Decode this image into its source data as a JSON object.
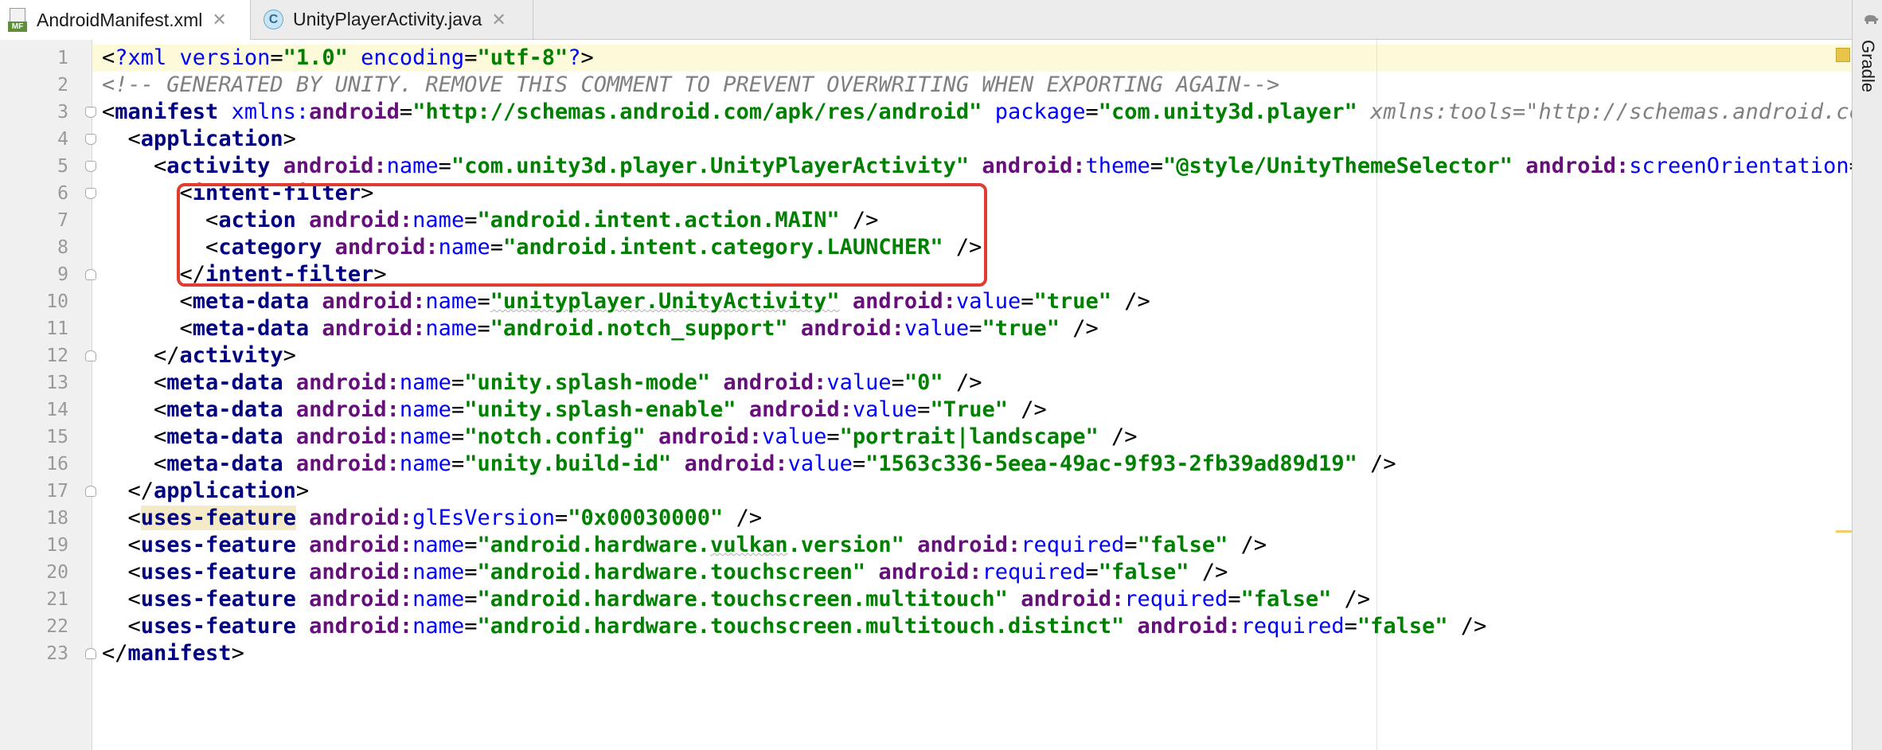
{
  "tabs": [
    {
      "label": "AndroidManifest.xml",
      "icon": "manifest-file-icon",
      "active": true
    },
    {
      "label": "UnityPlayerActivity.java",
      "icon": "java-class-icon",
      "active": false
    }
  ],
  "tab_close_glyph": "✕",
  "manifest_icon_badge": "MF",
  "java_icon_letter": "C",
  "side_panel": {
    "label": "Gradle",
    "icon": "gradle-icon"
  },
  "line_numbers": [
    "1",
    "2",
    "3",
    "4",
    "5",
    "6",
    "7",
    "8",
    "9",
    "10",
    "11",
    "12",
    "13",
    "14",
    "15",
    "16",
    "17",
    "18",
    "19",
    "20",
    "21",
    "22",
    "23"
  ],
  "lines": [
    [
      {
        "c": "p",
        "t": "<"
      },
      {
        "c": "pi",
        "t": "?xml version"
      },
      {
        "c": "p",
        "t": "="
      },
      {
        "c": "v",
        "t": "\"1.0\""
      },
      {
        "c": "pi",
        "t": " encoding"
      },
      {
        "c": "p",
        "t": "="
      },
      {
        "c": "v",
        "t": "\"utf-8\""
      },
      {
        "c": "pi",
        "t": "?"
      },
      {
        "c": "p",
        "t": ">"
      }
    ],
    [
      {
        "c": "cm",
        "t": "<!-- GENERATED BY UNITY. REMOVE THIS COMMENT TO PREVENT OVERWRITING WHEN EXPORTING AGAIN-->"
      }
    ],
    [
      {
        "c": "p",
        "t": "<"
      },
      {
        "c": "t",
        "t": "manifest"
      },
      {
        "c": "p",
        "t": " "
      },
      {
        "c": "an",
        "t": "xmlns:"
      },
      {
        "c": "ns",
        "t": "android"
      },
      {
        "c": "p",
        "t": "="
      },
      {
        "c": "v",
        "t": "\"http://schemas.android.com/apk/res/android\""
      },
      {
        "c": "p",
        "t": " "
      },
      {
        "c": "an",
        "t": "package"
      },
      {
        "c": "p",
        "t": "="
      },
      {
        "c": "v",
        "t": "\"com.unity3d.player\""
      },
      {
        "c": "p",
        "t": " "
      },
      {
        "c": "cm",
        "t": "xmlns:tools=\"http://schemas.android.com/"
      }
    ],
    [
      {
        "c": "p",
        "t": "  <"
      },
      {
        "c": "t",
        "t": "application"
      },
      {
        "c": "p",
        "t": ">"
      }
    ],
    [
      {
        "c": "p",
        "t": "    <"
      },
      {
        "c": "t",
        "t": "activity"
      },
      {
        "c": "p",
        "t": " "
      },
      {
        "c": "ns",
        "t": "android:"
      },
      {
        "c": "an",
        "t": "name"
      },
      {
        "c": "p",
        "t": "="
      },
      {
        "c": "v",
        "t": "\"com.unity3d.player.UnityPlayerActivity\""
      },
      {
        "c": "p",
        "t": " "
      },
      {
        "c": "ns",
        "t": "android:"
      },
      {
        "c": "an",
        "t": "theme"
      },
      {
        "c": "p",
        "t": "="
      },
      {
        "c": "v",
        "t": "\"@style/UnityThemeSelector\""
      },
      {
        "c": "p",
        "t": " "
      },
      {
        "c": "ns",
        "t": "android:"
      },
      {
        "c": "an",
        "t": "screenOrientation"
      },
      {
        "c": "p",
        "t": "="
      },
      {
        "c": "v",
        "t": "\"f"
      }
    ],
    [
      {
        "c": "p",
        "t": "      <"
      },
      {
        "c": "t",
        "t": "intent-filter"
      },
      {
        "c": "p",
        "t": ">"
      }
    ],
    [
      {
        "c": "p",
        "t": "        <"
      },
      {
        "c": "t",
        "t": "action"
      },
      {
        "c": "p",
        "t": " "
      },
      {
        "c": "ns",
        "t": "android:"
      },
      {
        "c": "an",
        "t": "name"
      },
      {
        "c": "p",
        "t": "="
      },
      {
        "c": "v",
        "t": "\"android.intent.action.MAIN\""
      },
      {
        "c": "p",
        "t": " />"
      }
    ],
    [
      {
        "c": "p",
        "t": "        <"
      },
      {
        "c": "t",
        "t": "category"
      },
      {
        "c": "p",
        "t": " "
      },
      {
        "c": "ns",
        "t": "android:"
      },
      {
        "c": "an",
        "t": "name"
      },
      {
        "c": "p",
        "t": "="
      },
      {
        "c": "v",
        "t": "\"android.intent.category.LAUNCHER\""
      },
      {
        "c": "p",
        "t": " />"
      }
    ],
    [
      {
        "c": "p",
        "t": "      </"
      },
      {
        "c": "t",
        "t": "intent-filter"
      },
      {
        "c": "p",
        "t": ">"
      }
    ],
    [
      {
        "c": "p",
        "t": "      <"
      },
      {
        "c": "t",
        "t": "meta-data"
      },
      {
        "c": "p",
        "t": " "
      },
      {
        "c": "ns",
        "t": "android:"
      },
      {
        "c": "an",
        "t": "name"
      },
      {
        "c": "p",
        "t": "="
      },
      {
        "c": "v squig",
        "t": "\"unityplayer.UnityActivity\""
      },
      {
        "c": "p",
        "t": " "
      },
      {
        "c": "ns",
        "t": "android:"
      },
      {
        "c": "an",
        "t": "value"
      },
      {
        "c": "p",
        "t": "="
      },
      {
        "c": "v",
        "t": "\"true\""
      },
      {
        "c": "p",
        "t": " />"
      }
    ],
    [
      {
        "c": "p",
        "t": "      <"
      },
      {
        "c": "t",
        "t": "meta-data"
      },
      {
        "c": "p",
        "t": " "
      },
      {
        "c": "ns",
        "t": "android:"
      },
      {
        "c": "an",
        "t": "name"
      },
      {
        "c": "p",
        "t": "="
      },
      {
        "c": "v",
        "t": "\"android.notch_support\""
      },
      {
        "c": "p",
        "t": " "
      },
      {
        "c": "ns",
        "t": "android:"
      },
      {
        "c": "an",
        "t": "value"
      },
      {
        "c": "p",
        "t": "="
      },
      {
        "c": "v",
        "t": "\"true\""
      },
      {
        "c": "p",
        "t": " />"
      }
    ],
    [
      {
        "c": "p",
        "t": "    </"
      },
      {
        "c": "t",
        "t": "activity"
      },
      {
        "c": "p",
        "t": ">"
      }
    ],
    [
      {
        "c": "p",
        "t": "    <"
      },
      {
        "c": "t",
        "t": "meta-data"
      },
      {
        "c": "p",
        "t": " "
      },
      {
        "c": "ns",
        "t": "android:"
      },
      {
        "c": "an",
        "t": "name"
      },
      {
        "c": "p",
        "t": "="
      },
      {
        "c": "v",
        "t": "\"unity.splash-mode\""
      },
      {
        "c": "p",
        "t": " "
      },
      {
        "c": "ns",
        "t": "android:"
      },
      {
        "c": "an",
        "t": "value"
      },
      {
        "c": "p",
        "t": "="
      },
      {
        "c": "v",
        "t": "\"0\""
      },
      {
        "c": "p",
        "t": " />"
      }
    ],
    [
      {
        "c": "p",
        "t": "    <"
      },
      {
        "c": "t",
        "t": "meta-data"
      },
      {
        "c": "p",
        "t": " "
      },
      {
        "c": "ns",
        "t": "android:"
      },
      {
        "c": "an",
        "t": "name"
      },
      {
        "c": "p",
        "t": "="
      },
      {
        "c": "v",
        "t": "\"unity.splash-enable\""
      },
      {
        "c": "p",
        "t": " "
      },
      {
        "c": "ns",
        "t": "android:"
      },
      {
        "c": "an",
        "t": "value"
      },
      {
        "c": "p",
        "t": "="
      },
      {
        "c": "v",
        "t": "\"True\""
      },
      {
        "c": "p",
        "t": " />"
      }
    ],
    [
      {
        "c": "p",
        "t": "    <"
      },
      {
        "c": "t",
        "t": "meta-data"
      },
      {
        "c": "p",
        "t": " "
      },
      {
        "c": "ns",
        "t": "android:"
      },
      {
        "c": "an",
        "t": "name"
      },
      {
        "c": "p",
        "t": "="
      },
      {
        "c": "v",
        "t": "\"notch.config\""
      },
      {
        "c": "p",
        "t": " "
      },
      {
        "c": "ns",
        "t": "android:"
      },
      {
        "c": "an",
        "t": "value"
      },
      {
        "c": "p",
        "t": "="
      },
      {
        "c": "v",
        "t": "\"portrait|landscape\""
      },
      {
        "c": "p",
        "t": " />"
      }
    ],
    [
      {
        "c": "p",
        "t": "    <"
      },
      {
        "c": "t",
        "t": "meta-data"
      },
      {
        "c": "p",
        "t": " "
      },
      {
        "c": "ns",
        "t": "android:"
      },
      {
        "c": "an",
        "t": "name"
      },
      {
        "c": "p",
        "t": "="
      },
      {
        "c": "v",
        "t": "\"unity.build-id\""
      },
      {
        "c": "p",
        "t": " "
      },
      {
        "c": "ns",
        "t": "android:"
      },
      {
        "c": "an",
        "t": "value"
      },
      {
        "c": "p",
        "t": "="
      },
      {
        "c": "v",
        "t": "\"1563c336-5eea-49ac-9f93-2fb39ad89d19\""
      },
      {
        "c": "p",
        "t": " />"
      }
    ],
    [
      {
        "c": "p",
        "t": "  </"
      },
      {
        "c": "t",
        "t": "application"
      },
      {
        "c": "p",
        "t": ">"
      }
    ],
    [
      {
        "c": "p",
        "t": "  <"
      },
      {
        "c": "t hl",
        "t": "uses-feature"
      },
      {
        "c": "p",
        "t": " "
      },
      {
        "c": "ns",
        "t": "android:"
      },
      {
        "c": "an",
        "t": "glEsVersion"
      },
      {
        "c": "p",
        "t": "="
      },
      {
        "c": "v",
        "t": "\"0x00030000\""
      },
      {
        "c": "p",
        "t": " />"
      }
    ],
    [
      {
        "c": "p",
        "t": "  <"
      },
      {
        "c": "t",
        "t": "uses-feature"
      },
      {
        "c": "p",
        "t": " "
      },
      {
        "c": "ns",
        "t": "android:"
      },
      {
        "c": "an",
        "t": "name"
      },
      {
        "c": "p",
        "t": "="
      },
      {
        "c": "v",
        "t": "\"android.hardware."
      },
      {
        "c": "v squig",
        "t": "vulkan"
      },
      {
        "c": "v",
        "t": ".version\""
      },
      {
        "c": "p",
        "t": " "
      },
      {
        "c": "ns",
        "t": "android:"
      },
      {
        "c": "an",
        "t": "required"
      },
      {
        "c": "p",
        "t": "="
      },
      {
        "c": "v",
        "t": "\"false\""
      },
      {
        "c": "p",
        "t": " />"
      }
    ],
    [
      {
        "c": "p",
        "t": "  <"
      },
      {
        "c": "t",
        "t": "uses-feature"
      },
      {
        "c": "p",
        "t": " "
      },
      {
        "c": "ns",
        "t": "android:"
      },
      {
        "c": "an",
        "t": "name"
      },
      {
        "c": "p",
        "t": "="
      },
      {
        "c": "v",
        "t": "\"android.hardware.touchscreen\""
      },
      {
        "c": "p",
        "t": " "
      },
      {
        "c": "ns",
        "t": "android:"
      },
      {
        "c": "an",
        "t": "required"
      },
      {
        "c": "p",
        "t": "="
      },
      {
        "c": "v",
        "t": "\"false\""
      },
      {
        "c": "p",
        "t": " />"
      }
    ],
    [
      {
        "c": "p",
        "t": "  <"
      },
      {
        "c": "t",
        "t": "uses-feature"
      },
      {
        "c": "p",
        "t": " "
      },
      {
        "c": "ns",
        "t": "android:"
      },
      {
        "c": "an",
        "t": "name"
      },
      {
        "c": "p",
        "t": "="
      },
      {
        "c": "v",
        "t": "\"android.hardware.touchscreen.multitouch\""
      },
      {
        "c": "p",
        "t": " "
      },
      {
        "c": "ns",
        "t": "android:"
      },
      {
        "c": "an",
        "t": "required"
      },
      {
        "c": "p",
        "t": "="
      },
      {
        "c": "v",
        "t": "\"false\""
      },
      {
        "c": "p",
        "t": " />"
      }
    ],
    [
      {
        "c": "p",
        "t": "  <"
      },
      {
        "c": "t",
        "t": "uses-feature"
      },
      {
        "c": "p",
        "t": " "
      },
      {
        "c": "ns",
        "t": "android:"
      },
      {
        "c": "an",
        "t": "name"
      },
      {
        "c": "p",
        "t": "="
      },
      {
        "c": "v",
        "t": "\"android.hardware.touchscreen.multitouch.distinct\""
      },
      {
        "c": "p",
        "t": " "
      },
      {
        "c": "ns",
        "t": "android:"
      },
      {
        "c": "an",
        "t": "required"
      },
      {
        "c": "p",
        "t": "="
      },
      {
        "c": "v",
        "t": "\"false\""
      },
      {
        "c": "p",
        "t": " />"
      }
    ],
    [
      {
        "c": "p",
        "t": "</"
      },
      {
        "c": "t",
        "t": "manifest"
      },
      {
        "c": "p",
        "t": ">"
      }
    ]
  ],
  "fold_markers": [
    {
      "line": 3,
      "kind": "open"
    },
    {
      "line": 4,
      "kind": "open"
    },
    {
      "line": 5,
      "kind": "open"
    },
    {
      "line": 6,
      "kind": "open"
    },
    {
      "line": 9,
      "kind": "close"
    },
    {
      "line": 12,
      "kind": "close"
    },
    {
      "line": 17,
      "kind": "close"
    },
    {
      "line": 23,
      "kind": "close"
    }
  ],
  "caret_line": 1,
  "highlight_box": {
    "from_line": 6,
    "to_line": 9,
    "color": "#e03c31"
  }
}
